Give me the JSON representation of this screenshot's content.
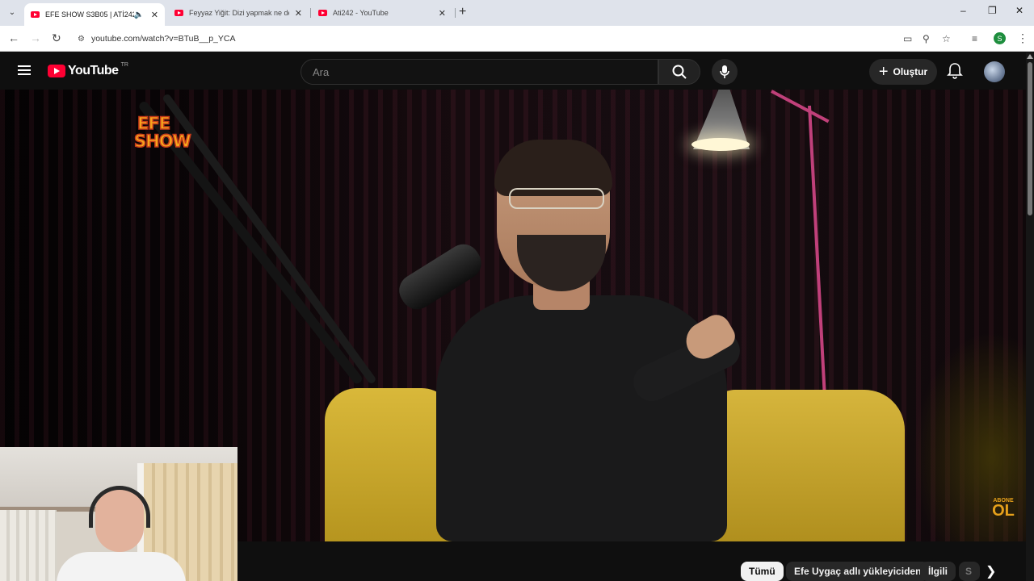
{
  "browser": {
    "tabs": [
      {
        "title": "EFE SHOW S3B05 | ATİ242 -",
        "active": true
      },
      {
        "title": "Feyyaz Yiğit: Dizi yapmak ne de",
        "active": false
      },
      {
        "title": "Ati242 - YouTube",
        "active": false
      }
    ],
    "url": "youtube.com/watch?v=BTuB__p_YCA",
    "profile_initial": "S",
    "icons": {
      "tab_search": "chevron-down-icon",
      "audio": "speaker-icon",
      "close": "close-icon",
      "new_tab": "plus-icon",
      "back": "back-arrow-icon",
      "forward": "forward-arrow-icon",
      "reload": "reload-icon",
      "site_info": "tune-icon",
      "cast": "cast-icon",
      "zoom": "zoom-icon",
      "bookmark": "star-icon",
      "reading_list": "reading-list-icon",
      "menu": "kebab-icon"
    }
  },
  "youtube": {
    "logo_text": "YouTube",
    "country_code": "TR",
    "search_placeholder": "Ara",
    "create_label": "Oluştur",
    "brand_color": "#ff0033"
  },
  "video": {
    "channel_watermark_line1": "EFE",
    "channel_watermark_line2": "SHOW",
    "subscribe_small": "ABONE",
    "subscribe_big": "OL"
  },
  "chips": [
    {
      "label": "Tümü",
      "active": true
    },
    {
      "label": "Efe Uygaç adlı yükleyiciden",
      "active": false
    },
    {
      "label": "İlgili",
      "active": false
    },
    {
      "label": "S",
      "active": false
    }
  ]
}
